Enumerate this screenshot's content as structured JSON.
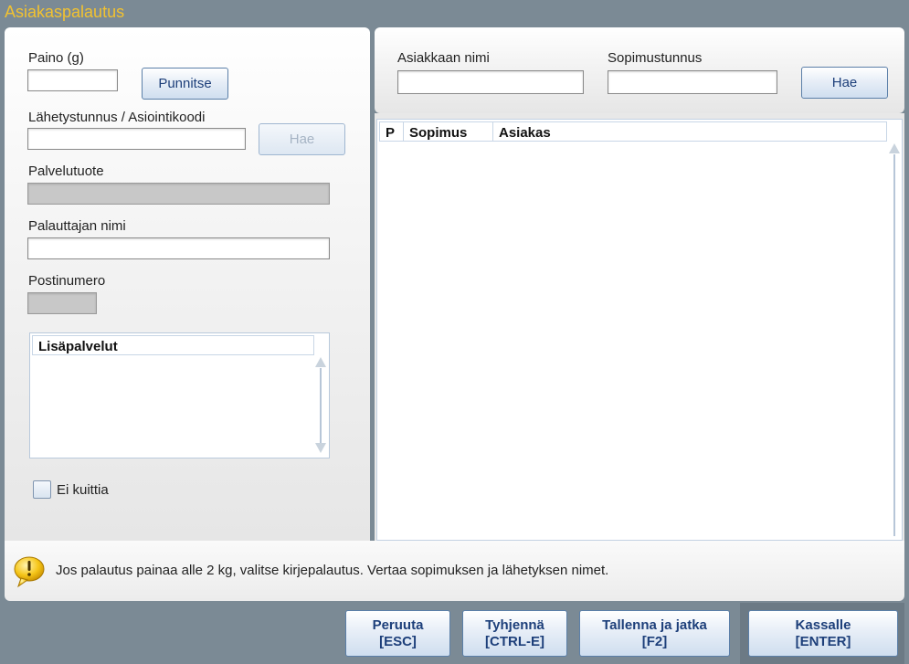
{
  "window": {
    "title": "Asiakaspalautus"
  },
  "left": {
    "weight_label": "Paino (g)",
    "weight_value": "",
    "weigh_button": "Punnitse",
    "shipment_label": "Lähetystunnus / Asiointikoodi",
    "shipment_value": "",
    "shipment_search_button": "Hae",
    "service_label": "Palvelutuote",
    "service_value": "",
    "returner_label": "Palauttajan nimi",
    "returner_value": "",
    "postal_label": "Postinumero",
    "postal_value": "",
    "extra_services": {
      "header": "Lisäpalvelut",
      "items": []
    },
    "no_receipt_label": "Ei kuittia"
  },
  "right": {
    "customer_name_label": "Asiakkaan nimi",
    "customer_name_value": "",
    "contract_id_label": "Sopimustunnus",
    "contract_id_value": "",
    "search_button": "Hae",
    "table": {
      "columns": [
        "P",
        "Sopimus",
        "Asiakas"
      ],
      "rows": []
    }
  },
  "info": {
    "icon": "warning-icon",
    "message": "Jos palautus painaa alle 2 kg, valitse kirjepalautus. Vertaa sopimuksen ja lähetyksen nimet."
  },
  "footer": {
    "cancel": {
      "label": "Peruuta",
      "shortcut": "[ESC]"
    },
    "clear": {
      "label": "Tyhjennä",
      "shortcut": "[CTRL-E]"
    },
    "save": {
      "label": "Tallenna ja jatka",
      "shortcut": "[F2]"
    },
    "checkout": {
      "label": "Kassalle",
      "shortcut": "[ENTER]"
    }
  },
  "colors": {
    "title": "#f2c230",
    "accent": "#1d3f7a",
    "background": "#7b8a95",
    "warning": "#f5c518"
  }
}
